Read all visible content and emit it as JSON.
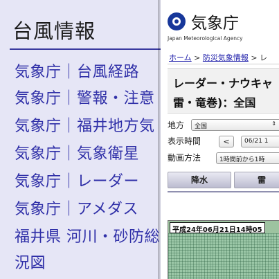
{
  "sidebar": {
    "title": "台風情報",
    "links": [
      "気象庁｜台風経路",
      "気象庁｜警報・注意",
      "気象庁｜福井地方気",
      "気象庁｜気象衛星",
      "気象庁｜レーダー",
      "気象庁｜アメダス",
      "福井県 河川・砂防総",
      "況図"
    ]
  },
  "jma": {
    "logo_text": "気象庁",
    "logo_en": "Japan Meteorological Agency",
    "breadcrumb": [
      "ホーム",
      "防災気象情報",
      "レ"
    ],
    "breadcrumb_sep": ">",
    "headline_line1": "レーダー・ナウキャ",
    "headline_line2": "雷・竜巻)：全国",
    "controls": {
      "region_label": "地方",
      "region_value": "全国",
      "time_label": "表示時間",
      "time_prev": "<",
      "time_value": "06/21 1",
      "anim_label": "動画方法",
      "anim_value": "1時間前から1時"
    },
    "tabs": [
      "降水",
      "雷"
    ],
    "map_timestamp": "平成24年06月21日14時05"
  }
}
